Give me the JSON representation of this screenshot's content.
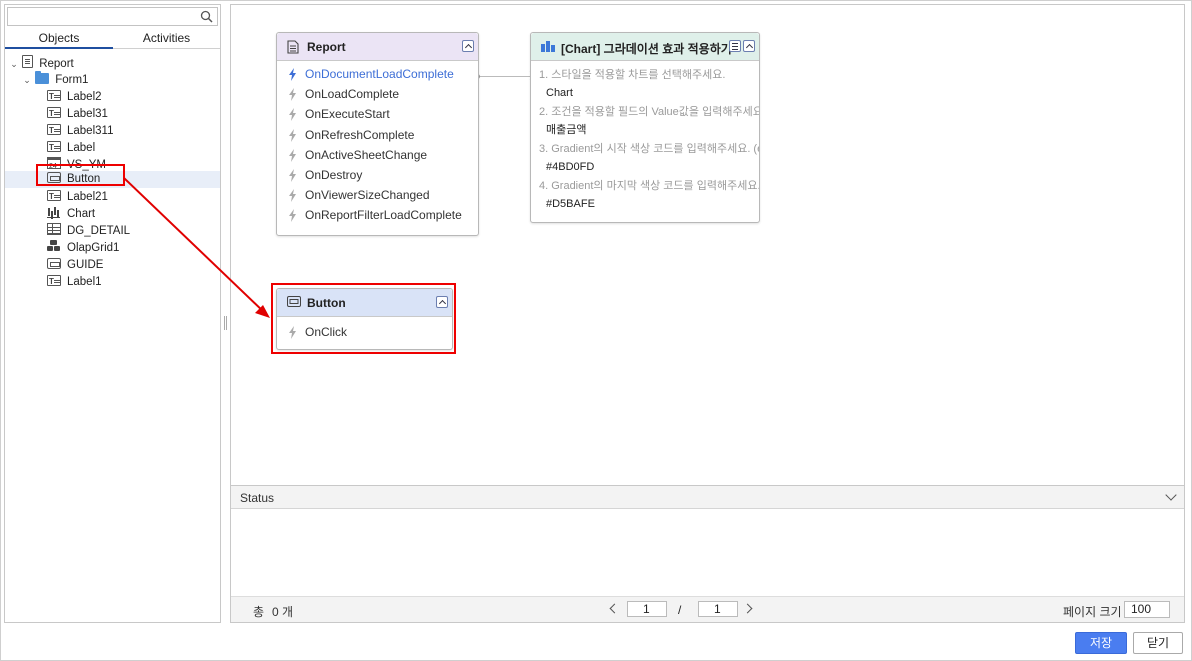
{
  "search": {
    "placeholder": "",
    "value": ""
  },
  "tabs": {
    "objects": "Objects",
    "activities": "Activities"
  },
  "tree": [
    {
      "label": "Report",
      "icon": "document-icon"
    },
    {
      "label": "Form1",
      "icon": "folder-icon"
    },
    {
      "label": "Label2",
      "icon": "label-icon"
    },
    {
      "label": "Label31",
      "icon": "label-icon"
    },
    {
      "label": "Label311",
      "icon": "label-icon"
    },
    {
      "label": "Label",
      "icon": "label-icon"
    },
    {
      "label": "VS_YM",
      "icon": "calendar-icon"
    },
    {
      "label": "Button",
      "icon": "button-icon"
    },
    {
      "label": "Label21",
      "icon": "label-icon"
    },
    {
      "label": "Chart",
      "icon": "chart-icon"
    },
    {
      "label": "DG_DETAIL",
      "icon": "grid-icon"
    },
    {
      "label": "OlapGrid1",
      "icon": "olap-icon"
    },
    {
      "label": "GUIDE",
      "icon": "button-icon"
    },
    {
      "label": "Label1",
      "icon": "label-icon"
    }
  ],
  "report_node": {
    "title": "Report",
    "events": [
      "OnDocumentLoadComplete",
      "OnLoadComplete",
      "OnExecuteStart",
      "OnRefreshComplete",
      "OnActiveSheetChange",
      "OnDestroy",
      "OnViewerSizeChanged",
      "OnReportFilterLoadComplete"
    ]
  },
  "chart_node": {
    "title": "[Chart] 그라데이션 효과 적용하기",
    "params": [
      {
        "label": "1. 스타일을 적용할 차트를 선택해주세요.",
        "value": "Chart"
      },
      {
        "label": "2. 조건을 적용할 필드의 Value값을 입력해주세요",
        "value": "매출금액"
      },
      {
        "label": "3. Gradient의 시작 색상 코드를 입력해주세요. (e",
        "value": "#4BD0FD"
      },
      {
        "label": "4. Gradient의 마지막 색상 코드를 입력해주세요.",
        "value": "#D5BAFE"
      }
    ]
  },
  "button_node": {
    "title": "Button",
    "events": [
      "OnClick"
    ]
  },
  "status": {
    "label": "Status"
  },
  "pager": {
    "total_label": "총",
    "total_count": "0 개",
    "current_page": "1",
    "separator": "/",
    "total_pages": "1",
    "page_size_label": "페이지 크기",
    "page_size": "100"
  },
  "footer": {
    "save": "저장",
    "close": "닫기"
  },
  "colors": {
    "accent": "#4a7df0",
    "highlight_red": "#e00000",
    "active_event": "#3d6ed6",
    "report_header": "#ebe4f5",
    "chart_header": "#dff0ea",
    "button_header": "#d9e3f7"
  }
}
